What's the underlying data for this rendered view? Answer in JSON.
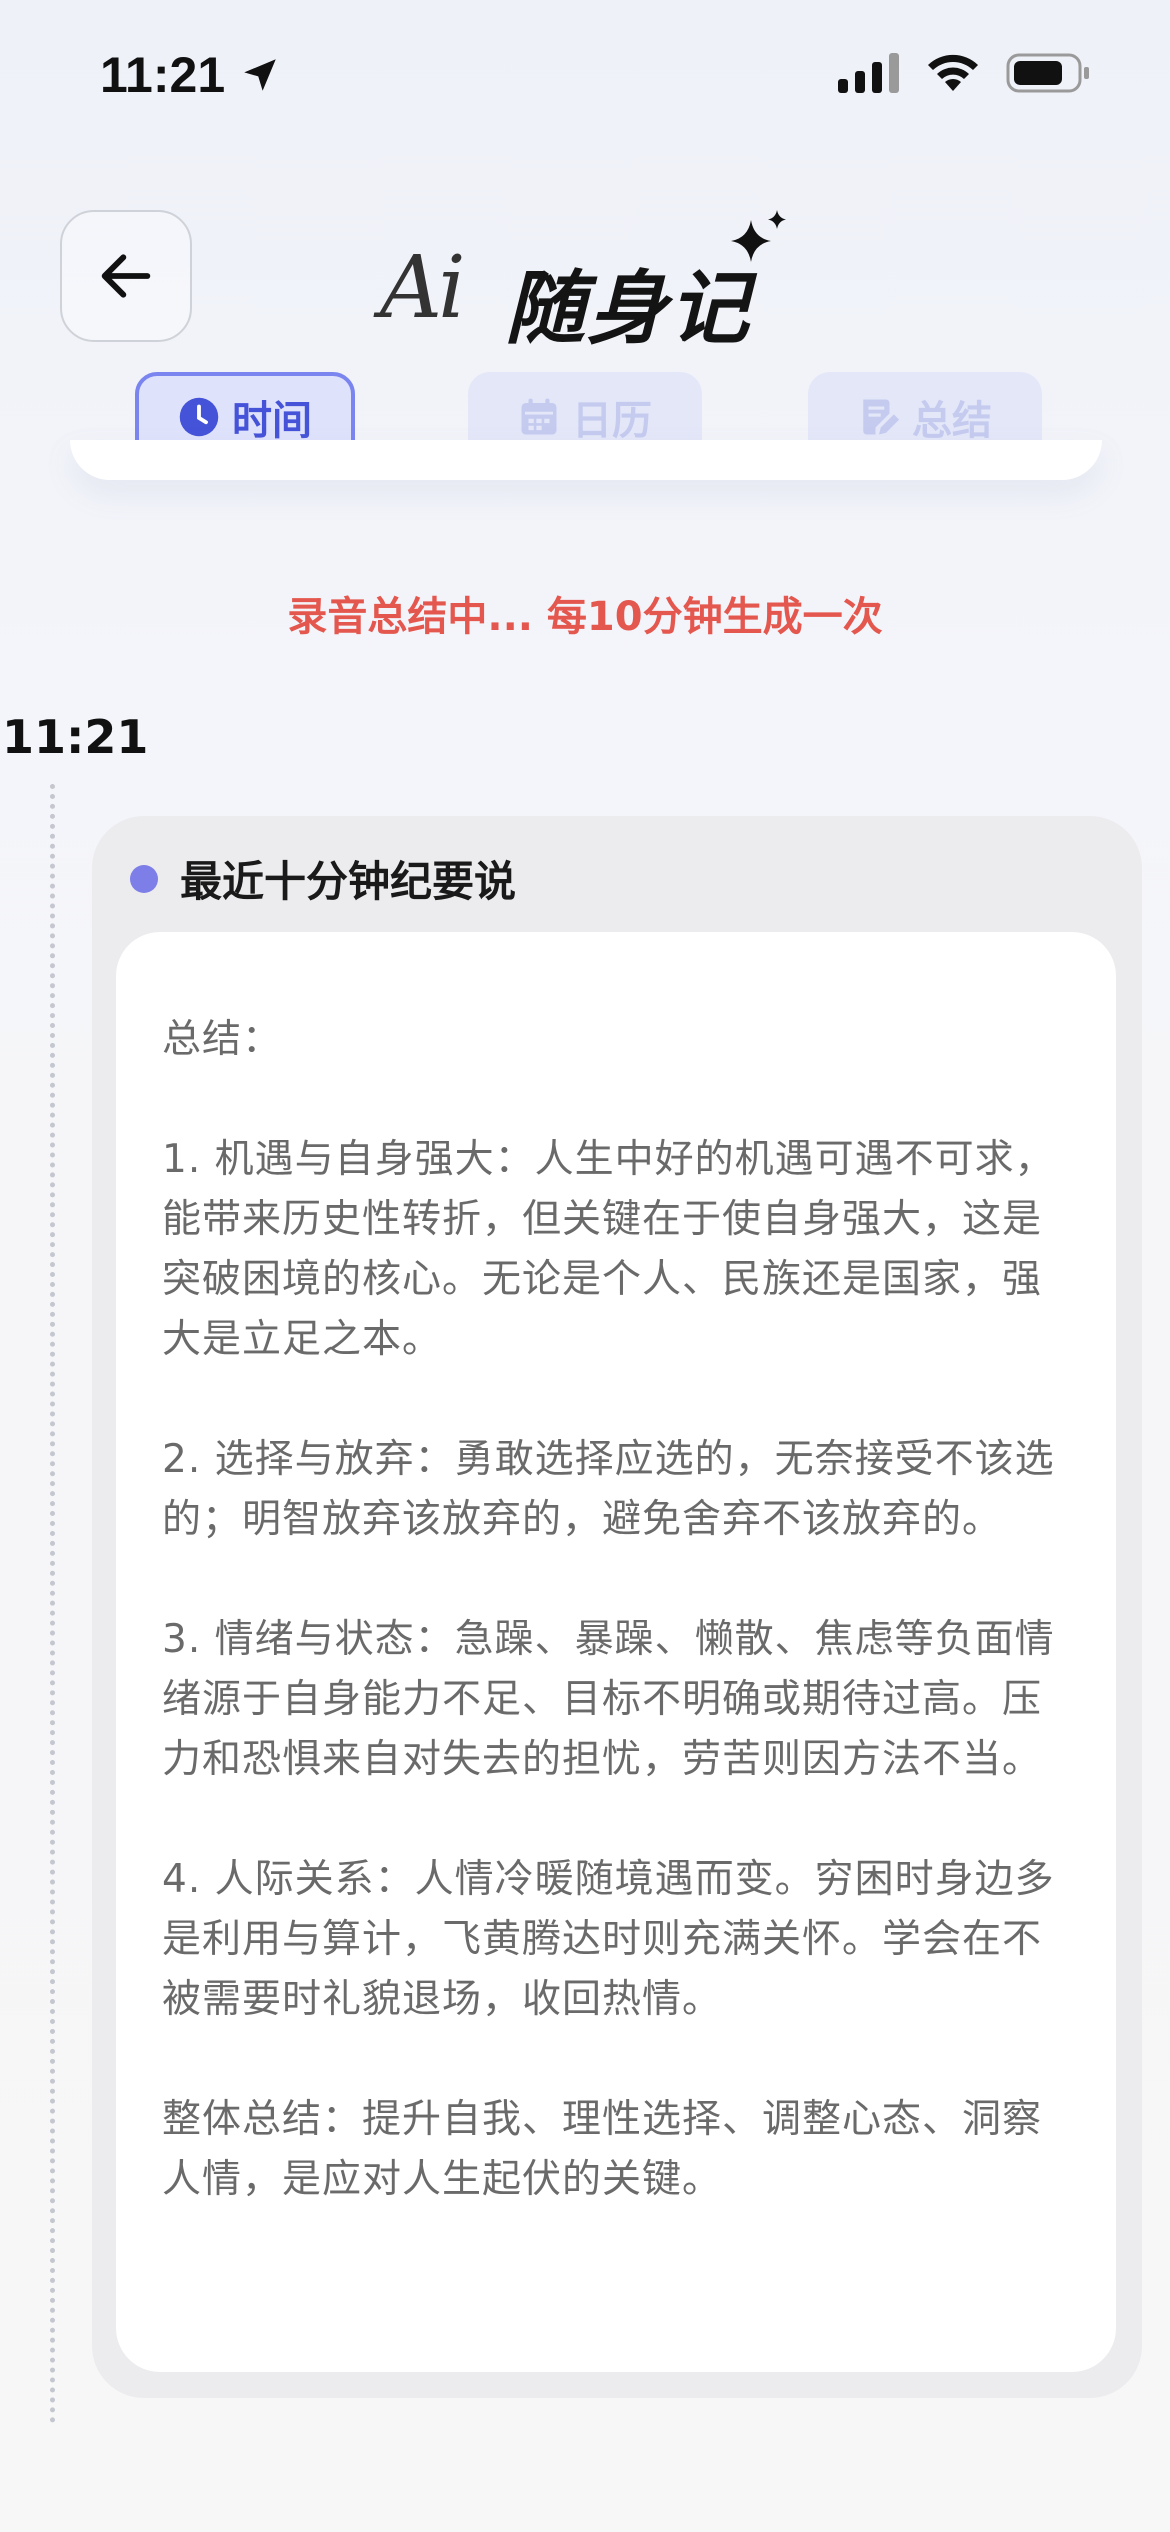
{
  "status_bar": {
    "time": "11:21"
  },
  "header": {
    "logo_script": "Ai",
    "logo_text": "随身记"
  },
  "tabs": [
    {
      "label": "时间",
      "active": true
    },
    {
      "label": "日历",
      "active": false
    },
    {
      "label": "总结",
      "active": false
    }
  ],
  "recording_status": "录音总结中... 每10分钟生成一次",
  "timeline": {
    "time": "11:21"
  },
  "summary": {
    "title": "最近十分钟纪要说",
    "heading": "总结：",
    "points": [
      "1. 机遇与自身强大：人生中好的机遇可遇不可求，能带来历史性转折，但关键在于使自身强大，这是突破困境的核心。无论是个人、民族还是国家，强大是立足之本。",
      "2. 选择与放弃：勇敢选择应选的，无奈接受不该选的；明智放弃该放弃的，避免舍弃不该放弃的。",
      "3. 情绪与状态：急躁、暴躁、懒散、焦虑等负面情绪源于自身能力不足、目标不明确或期待过高。压力和恐惧来自对失去的担忧，劳苦则因方法不当。",
      "4. 人际关系：人情冷暖随境遇而变。穷困时身边多是利用与算计，飞黄腾达时则充满关怀。学会在不被需要时礼貌退场，收回热情。"
    ],
    "conclusion": "整体总结：提升自我、理性选择、调整心态、洞察人情，是应对人生起伏的关键。"
  },
  "colors": {
    "accent": "#7b85ef",
    "accent_text": "#4553d9",
    "recording": "#e4574e",
    "dot": "#7d7ee8"
  },
  "icons": [
    "location-arrow-icon",
    "signal-icon",
    "wifi-icon",
    "battery-icon",
    "back-arrow-icon",
    "sparkle-icon",
    "clock-icon",
    "calendar-icon",
    "edit-note-icon"
  ]
}
